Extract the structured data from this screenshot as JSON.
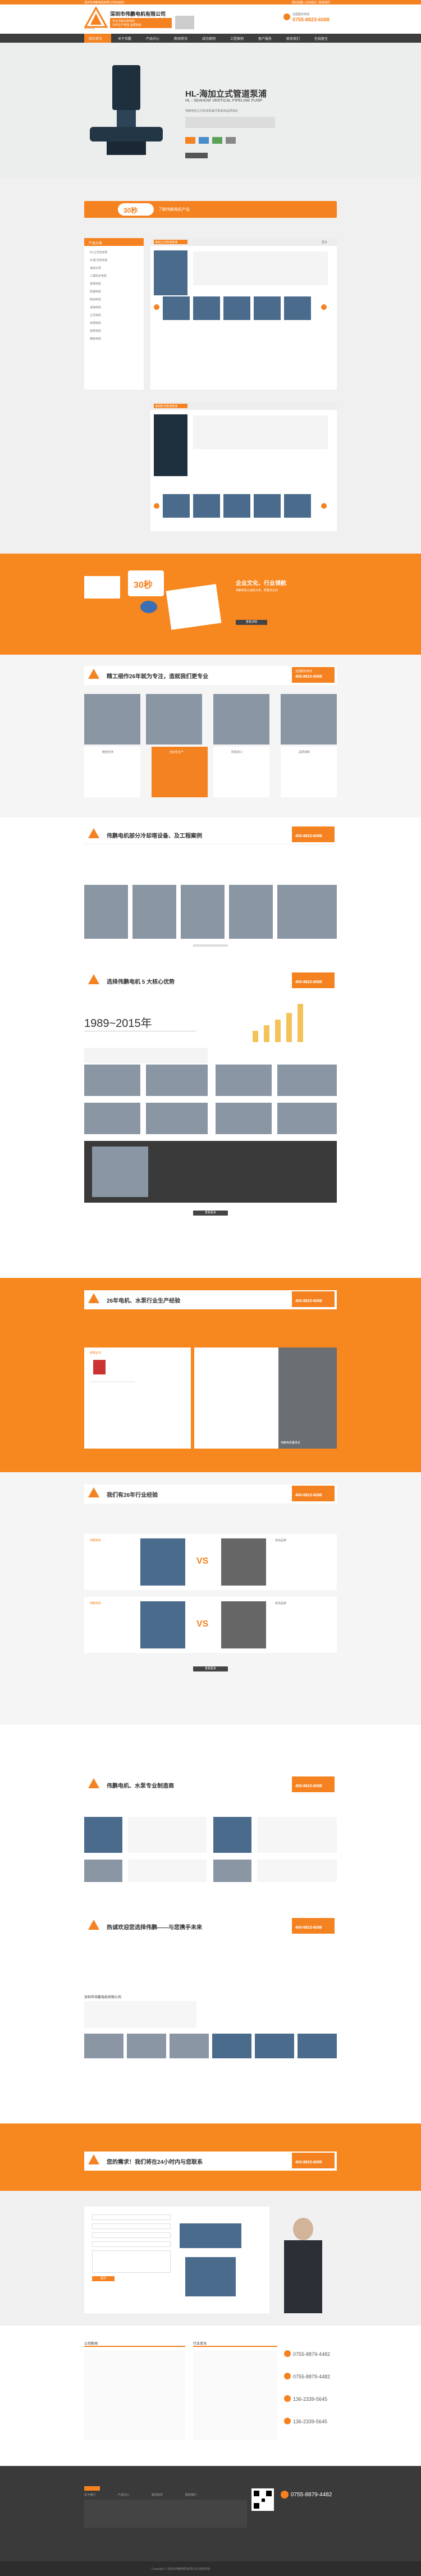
{
  "header": {
    "top_left": "深圳市伟鹏电机有限公司欢迎您！",
    "top_right": "网站地图 | 在线留言 | 联系我们",
    "company": "深圳市伟鹏电机有限公司",
    "slogan_1": "专业节能水泵电机",
    "slogan_2": "26年生产经验 品质保证",
    "hotline_label": "全国服务热线",
    "hotline": "0755-8823-6088",
    "logo_text": "WEIPENG"
  },
  "nav": {
    "items": [
      "网站首页",
      "关于伟鹏",
      "产品中心",
      "新闻资讯",
      "成功案例",
      "工程案例",
      "客户服务",
      "联系我们",
      "在线留言"
    ]
  },
  "banner": {
    "title": "HL-海加立式管道泵浦",
    "subtitle": "HL - SEAHOW VERTICAL PIPELINE PUMP",
    "desc": "伟鹏电机|立式管道泵浦|节能高效|品质保证"
  },
  "section1": {
    "badge": "30秒",
    "title": "了解伟鹏电机产品",
    "sidebar_title": "产品分类",
    "sidebar_items": [
      "HL立式管道泵",
      "HL卧式管道泵",
      "海加水泵",
      "三相异步电机",
      "变频电机",
      "防爆电机",
      "制动电机",
      "减速电机",
      "立式电机",
      "单相电机",
      "铝壳电机",
      "铸铁电机"
    ],
    "product_a": "海加立式管道泵浦",
    "product_b": "海加卧式管道泵浦",
    "more": "更多"
  },
  "culture": {
    "title": "企业文化、行业领航",
    "desc": "伟鹏电机以诚信为本，质量求生存",
    "btn": "查看详情",
    "badge": "30秒"
  },
  "advantage1": {
    "title": "精工细作26年就为专注，造就我们更专业",
    "hotline_label": "全国服务热线",
    "hotline": "400-8823-6088",
    "items": [
      "精密检测",
      "自动化生产",
      "原装进口",
      "品质保障"
    ]
  },
  "cases": {
    "title": "伟鹏电机部分冷却塔设备、及工程案例",
    "hotline": "400-8823-6088"
  },
  "why": {
    "title": "选择伟鹏电机 5 大核心优势",
    "hotline": "400-8823-6088",
    "years": "1989~2015年",
    "btn": "查看更多"
  },
  "years26": {
    "title": "26年电机、水泵行业生产经验",
    "hotline": "400-8823-6088",
    "left_label": "荣誉证书",
    "right_caption": "伟鹏电机董事长"
  },
  "industry": {
    "title": "我们有26年行业经验",
    "hotline": "400-8823-6088",
    "vs": "VS",
    "labels": [
      "伟鹏电机",
      "其他品牌",
      "伟鹏电机",
      "其他品牌"
    ],
    "btn": "查看更多"
  },
  "brand": {
    "title": "伟鹏电机、水泵专业制造商",
    "hotline": "400-8823-6088"
  },
  "welcome": {
    "title": "热诚欢迎您选择伟鹏——与您携手未来",
    "hotline": "400-8823-6088",
    "company": "深圳市伟鹏电机有限公司"
  },
  "contact24": {
    "title": "您的需求！我们将在24小时内与您联系",
    "hotline": "400-8823-6088",
    "form_btn": "提交"
  },
  "news": {
    "tab1": "公司新闻",
    "tab2": "行业资讯",
    "phone1": "0755-8879-4482",
    "phone2": "0755-8879-4482",
    "phone3": "136-2339-5645",
    "phone4": "136-2339-5645"
  },
  "footer": {
    "hotline": "0755-8879-4482",
    "copyright": "Copyright © 深圳市伟鹏电机有限公司 版权所有",
    "cols": [
      "关于我们",
      "产品中心",
      "新闻资讯",
      "联系我们"
    ]
  }
}
